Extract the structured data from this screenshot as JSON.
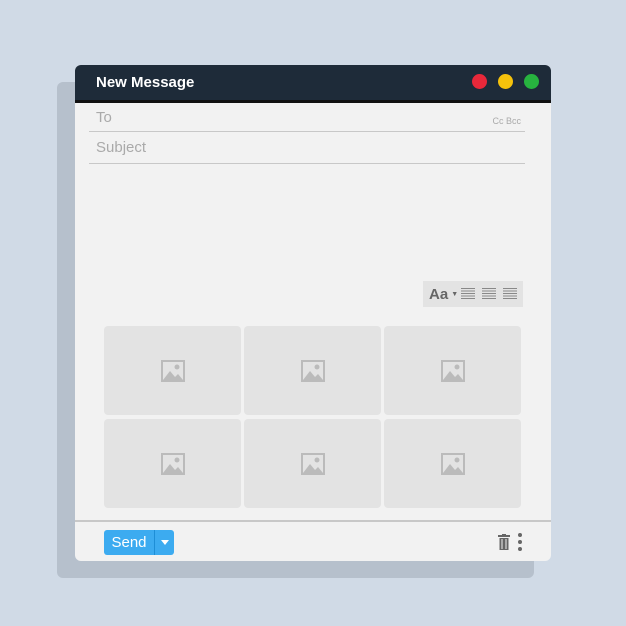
{
  "window": {
    "title": "New Message",
    "controls": [
      {
        "name": "close",
        "color": "#e8283a"
      },
      {
        "name": "minimize",
        "color": "#f5c20c"
      },
      {
        "name": "maximize",
        "color": "#27b33f"
      }
    ]
  },
  "compose": {
    "to_placeholder": "To",
    "cc_bcc": "Cc Bcc",
    "subject_placeholder": "Subject"
  },
  "format_toolbar": {
    "font_label": "Aa",
    "align": [
      "align-left",
      "align-center",
      "align-right"
    ]
  },
  "attachments": {
    "count_shown": 6,
    "icon": "image-icon"
  },
  "footer": {
    "send_label": "Send",
    "icons": [
      "trash-icon",
      "more-vertical-icon"
    ]
  },
  "colors": {
    "accent": "#3cabf0",
    "titlebar": "#1e2b39"
  }
}
